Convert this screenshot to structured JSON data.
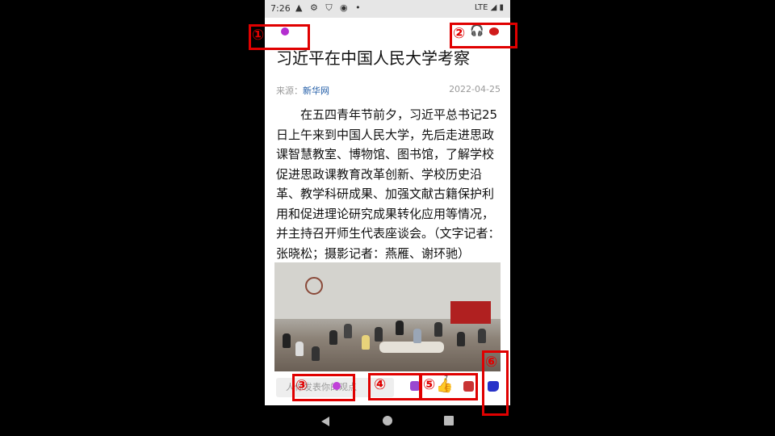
{
  "status_bar": {
    "time": "7:26",
    "left_icons": "▲ ⚙ ⛉ ◉ •",
    "network": "LTE"
  },
  "article": {
    "title": "习近平在中国人民大学考察",
    "source_prefix": "来源：",
    "source_name": "新华网",
    "date": "2022-04-25",
    "body": "在五四青年节前夕，习近平总书记25日上午来到中国人民大学，先后走进思政课智慧教室、博物馆、图书馆，了解学校促进思政课教育改革创新、学校历史沿革、教学科研成果、加强文献古籍保护利用和促进理论研究成果转化应用等情况，并主持召开师生代表座谈会。（文字记者：张晓松；摄影记者：燕雁、谢环驰）"
  },
  "top_bar": {
    "headphone_icon": "🎧"
  },
  "bottom_bar": {
    "comment_placeholder": "人你发表你的观点",
    "like_count": "7",
    "thumb_icon": "👍"
  },
  "annotations": [
    "①",
    "②",
    "③",
    "④",
    "⑤",
    "⑥"
  ],
  "colors": {
    "accent_purple": "#b32ecf",
    "record_red": "#d01b1b",
    "favorite_blue": "#2832c8",
    "annotation_red": "#e00000"
  }
}
